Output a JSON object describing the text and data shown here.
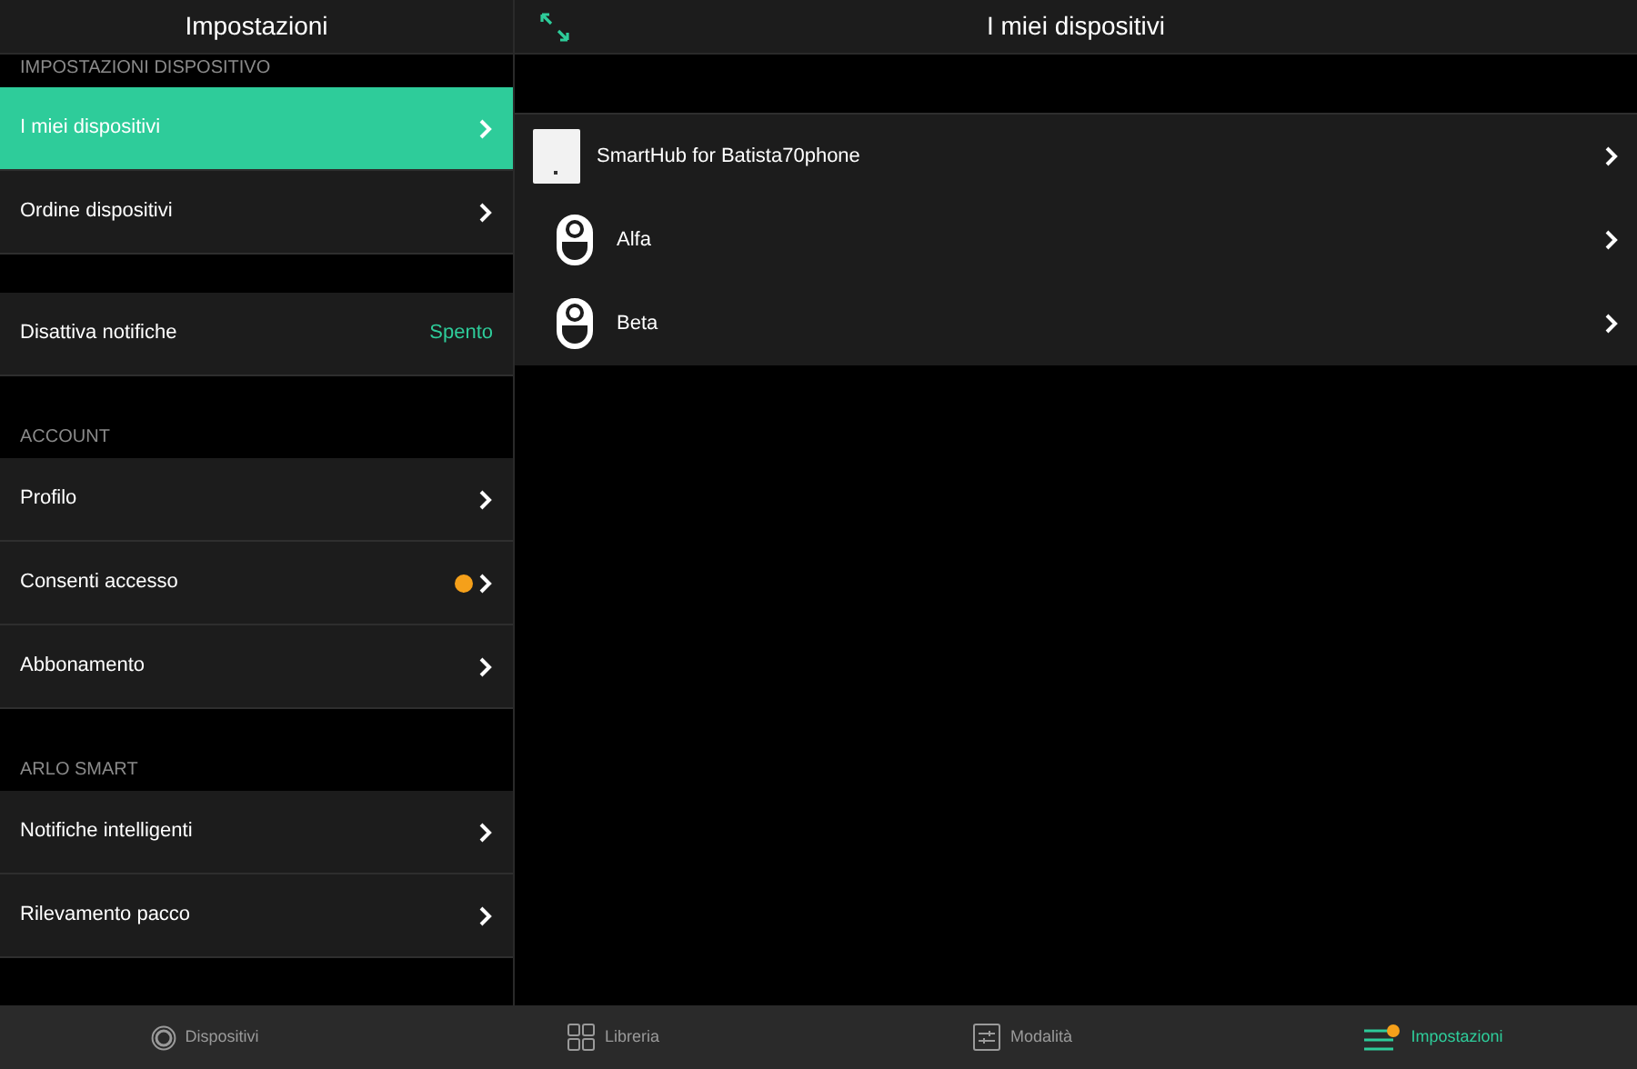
{
  "sidebar": {
    "title": "Impostazioni",
    "sections": [
      {
        "header": "IMPOSTAZIONI DISPOSITIVO",
        "items": [
          {
            "label": "I miei dispositivi",
            "selected": true
          },
          {
            "label": "Ordine dispositivi",
            "selected": false
          }
        ]
      },
      {
        "items": [
          {
            "label": "Disattiva notifiche",
            "selected": false,
            "value": "Spento"
          }
        ]
      },
      {
        "header": "ACCOUNT",
        "items": [
          {
            "label": "Profilo",
            "selected": false
          },
          {
            "label": "Consenti accesso",
            "selected": false,
            "color": "#f5a01a"
          },
          {
            "label": "Abbonamento",
            "selected": false
          }
        ]
      },
      {
        "header": "ARLO SMART",
        "items": [
          {
            "label": "Notifiche intelligenti",
            "selected": false
          },
          {
            "label": "Rilevamento pacco",
            "selected": false
          }
        ]
      }
    ]
  },
  "detail": {
    "title": "I miei dispositivi",
    "devices": [
      {
        "kind": "hub",
        "name": "SmartHub for Batista70phone"
      },
      {
        "kind": "camera",
        "name": "Alfa"
      },
      {
        "kind": "camera",
        "name": "Beta"
      }
    ]
  },
  "tab_bar": [
    {
      "kind": "devices",
      "label": "Dispositivi",
      "selected": false
    },
    {
      "kind": "library",
      "label": "Libreria",
      "selected": false
    },
    {
      "kind": "modes",
      "label": "Modalità",
      "selected": false
    },
    {
      "kind": "settings",
      "label": "Impostazioni",
      "selected": true,
      "color": "#f5a01a"
    }
  ]
}
